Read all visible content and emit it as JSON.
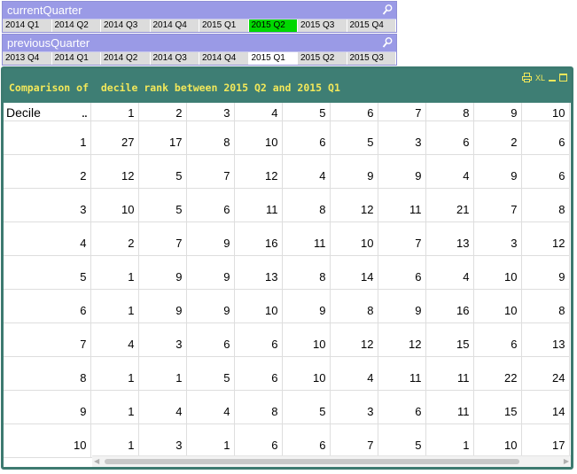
{
  "current_quarter": {
    "title": "currentQuarter",
    "items": [
      "2014 Q1",
      "2014 Q2",
      "2014 Q3",
      "2014 Q4",
      "2015 Q1",
      "2015 Q2",
      "2015 Q3",
      "2015 Q4"
    ],
    "selected": "2015 Q2"
  },
  "previous_quarter": {
    "title": "previousQuarter",
    "items": [
      "2013 Q4",
      "2014 Q1",
      "2014 Q2",
      "2014 Q3",
      "2014 Q4",
      "2015 Q1",
      "2015 Q2",
      "2015 Q3"
    ],
    "possible": "2015 Q1"
  },
  "chart": {
    "title": "Comparison of  decile rank between 2015 Q2 and 2015 Q1",
    "xl_label": "XL",
    "header_dimension": "Decile",
    "sort_indicator": "..",
    "columns": [
      "1",
      "2",
      "3",
      "4",
      "5",
      "6",
      "7",
      "8",
      "9",
      "10"
    ],
    "rows": [
      {
        "label": "1",
        "values": [
          "27",
          "17",
          "8",
          "10",
          "6",
          "5",
          "3",
          "6",
          "2",
          "6"
        ]
      },
      {
        "label": "2",
        "values": [
          "12",
          "5",
          "7",
          "12",
          "4",
          "9",
          "9",
          "4",
          "9",
          "6"
        ]
      },
      {
        "label": "3",
        "values": [
          "10",
          "5",
          "6",
          "11",
          "8",
          "12",
          "11",
          "21",
          "7",
          "8"
        ]
      },
      {
        "label": "4",
        "values": [
          "2",
          "7",
          "9",
          "16",
          "11",
          "10",
          "7",
          "13",
          "3",
          "12"
        ]
      },
      {
        "label": "5",
        "values": [
          "1",
          "9",
          "9",
          "13",
          "8",
          "14",
          "6",
          "4",
          "10",
          "9"
        ]
      },
      {
        "label": "6",
        "values": [
          "1",
          "9",
          "9",
          "10",
          "9",
          "8",
          "9",
          "16",
          "10",
          "8"
        ]
      },
      {
        "label": "7",
        "values": [
          "4",
          "3",
          "6",
          "6",
          "10",
          "12",
          "12",
          "15",
          "6",
          "13"
        ]
      },
      {
        "label": "8",
        "values": [
          "1",
          "1",
          "5",
          "6",
          "10",
          "4",
          "11",
          "11",
          "22",
          "24"
        ]
      },
      {
        "label": "9",
        "values": [
          "1",
          "4",
          "4",
          "8",
          "5",
          "3",
          "6",
          "11",
          "15",
          "14"
        ]
      },
      {
        "label": "10",
        "values": [
          "1",
          "3",
          "1",
          "6",
          "6",
          "7",
          "5",
          "1",
          "10",
          "17"
        ]
      }
    ]
  },
  "colors": {
    "listbox_title": "#9a9ae6",
    "selected": "#00d800",
    "chart_header": "#3e7e74",
    "chart_title_text": "#f2e85a"
  },
  "icons": {
    "listbox_search": "search-icon",
    "print": "print-icon",
    "minimize": "minimize-icon",
    "maximize": "maximize-icon"
  }
}
